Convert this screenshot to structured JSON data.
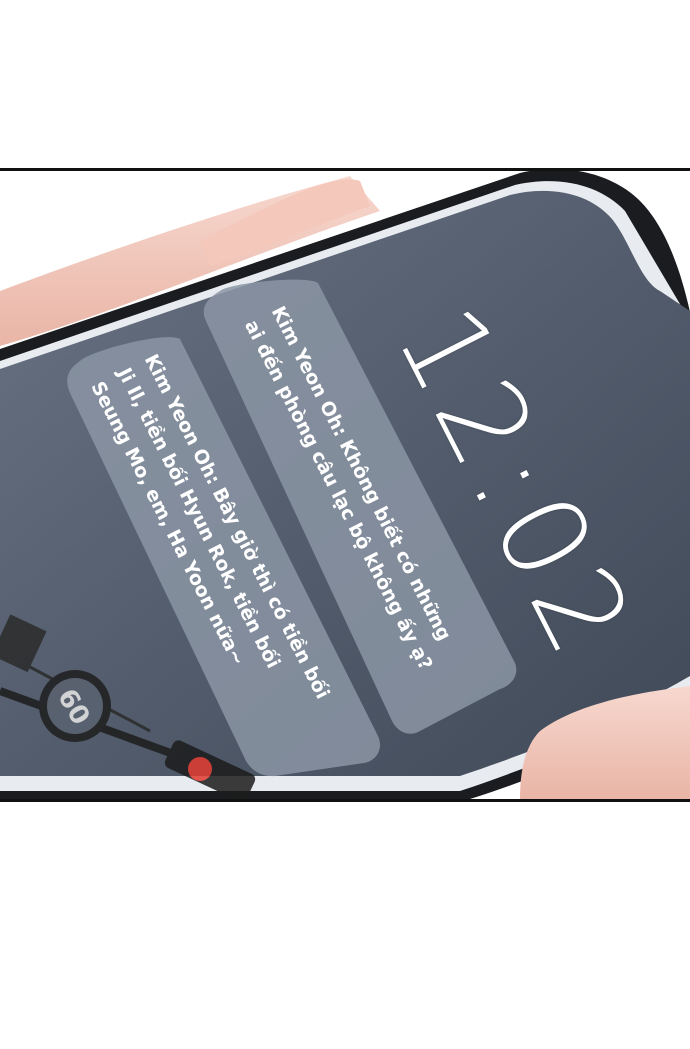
{
  "lock_screen": {
    "time": "12:02",
    "notifications": [
      {
        "lines": [
          "Kim Yeon Oh: Không biết có những",
          "ai đến phòng câu lạc bộ không ấy ạ?"
        ]
      },
      {
        "lines": [
          "Kim Yeon Oh: Bây giờ thì có tiền bối",
          "Ji Il, tiền bối Hyun Rok, tiền bối",
          "Seung Mo, em, Ha Yoon nữa~"
        ]
      }
    ]
  },
  "background": {
    "speed_sign": "60"
  },
  "colors": {
    "screen": "#4f5a6a",
    "notification_card": "#8b95a4",
    "skin": "#f2c9bc",
    "phone_frame": "#1a1c20"
  }
}
